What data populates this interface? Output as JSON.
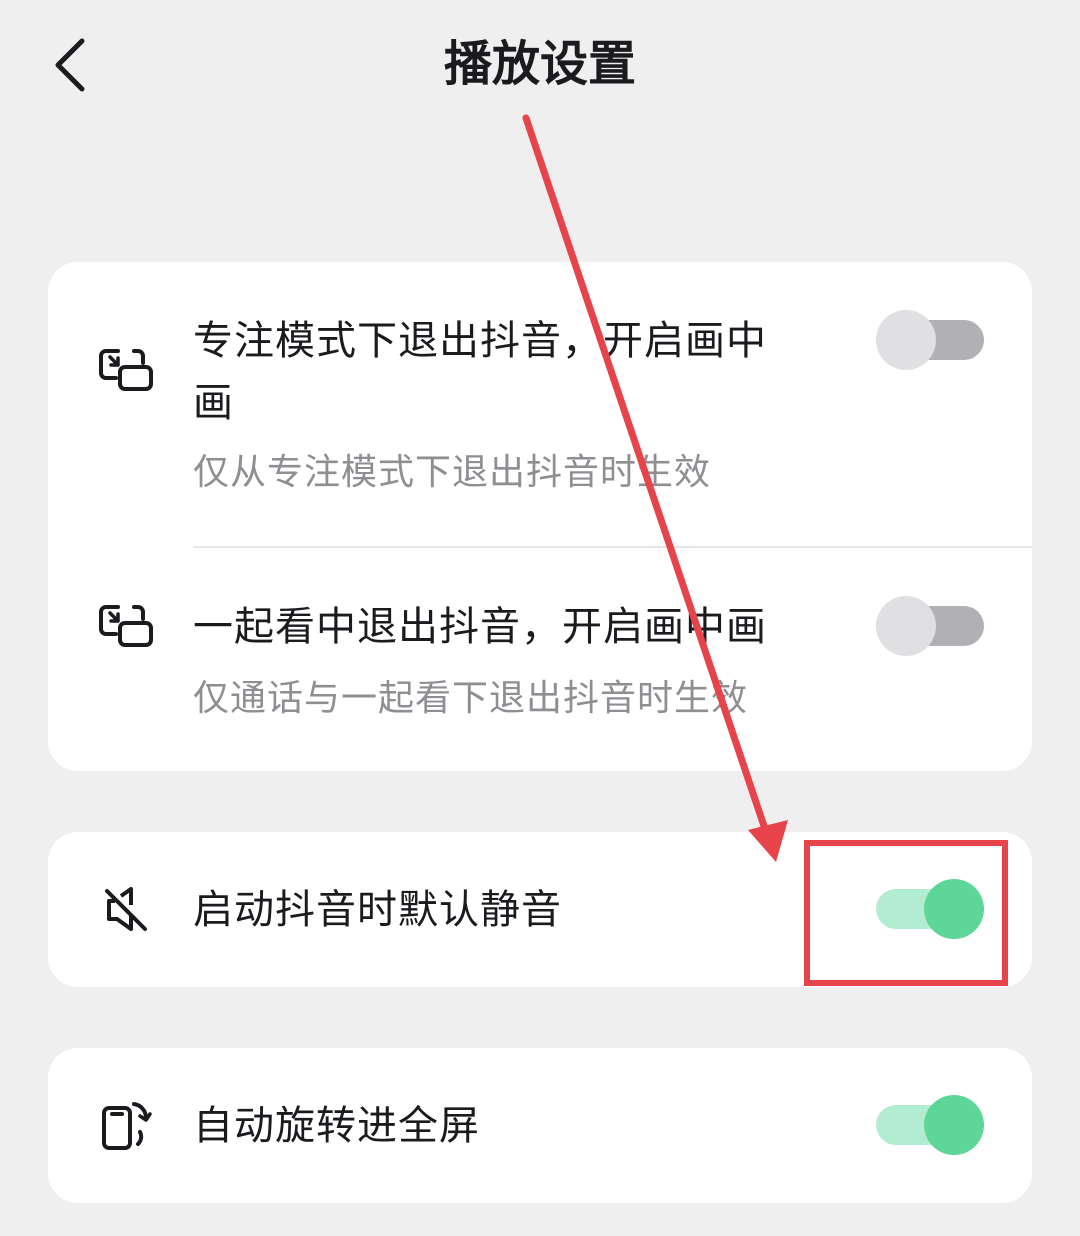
{
  "header": {
    "title": "播放设置",
    "back_icon": "chevron-left-icon"
  },
  "card1": {
    "items": [
      {
        "icon": "picture-in-picture-icon",
        "title_line1": "专注模式下退出抖音，开启画中",
        "title_line2": "画",
        "subtitle": "仅从专注模式下退出抖音时生效",
        "toggle": "off"
      },
      {
        "icon": "picture-in-picture-icon",
        "title": "一起看中退出抖音，开启画中画",
        "subtitle": "仅通话与一起看下退出抖音时生效",
        "toggle": "off"
      }
    ]
  },
  "card2": {
    "icon": "speaker-muted-icon",
    "title": "启动抖音时默认静音",
    "toggle": "on"
  },
  "card3": {
    "icon": "auto-rotate-icon",
    "title": "自动旋转进全屏",
    "toggle": "on"
  },
  "colors": {
    "background": "#efefef",
    "card": "#ffffff",
    "text_primary": "#1b1b1f",
    "text_secondary": "#8e8e93",
    "toggle_on_knob": "#5ed697",
    "toggle_on_track": "#b2ecd1",
    "toggle_off_knob": "#e0e0e3",
    "toggle_off_track": "#b0b0b5",
    "annotation": "#e6434a"
  }
}
